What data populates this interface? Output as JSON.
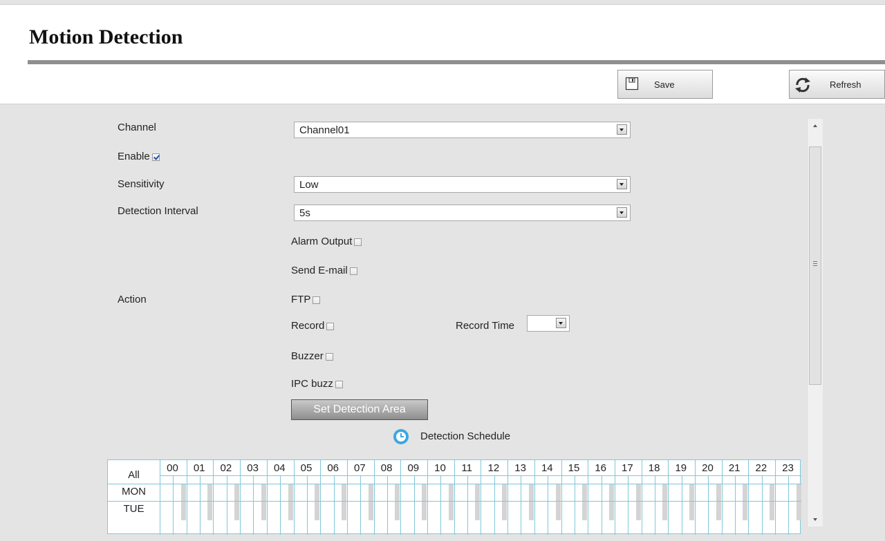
{
  "header": {
    "title": "Motion Detection",
    "save_label": "Save",
    "refresh_label": "Refresh"
  },
  "form": {
    "channel_label": "Channel",
    "channel_value": "Channel01",
    "enable_label": "Enable",
    "enable_checked": true,
    "sensitivity_label": "Sensitivity",
    "sensitivity_value": "Low",
    "interval_label": "Detection Interval",
    "interval_value": "5s",
    "action_label": "Action",
    "actions": {
      "alarm_output": "Alarm Output",
      "send_email": "Send E-mail",
      "ftp": "FTP",
      "record": "Record",
      "record_time": "Record Time",
      "record_time_value": "",
      "buzzer": "Buzzer",
      "ipc_buzz": "IPC buzz"
    },
    "set_area_button": "Set Detection Area",
    "schedule_title": "Detection Schedule"
  },
  "schedule": {
    "all_label": "All",
    "days": [
      "MON",
      "TUE"
    ],
    "hours": [
      "00",
      "01",
      "02",
      "03",
      "04",
      "05",
      "06",
      "07",
      "08",
      "09",
      "10",
      "11",
      "12",
      "13",
      "14",
      "15",
      "16",
      "17",
      "18",
      "19",
      "20",
      "21",
      "22",
      "23"
    ]
  },
  "colors": {
    "grid_line": "#7fc8d8",
    "schedule_icon": "#3aa8e0",
    "title_rule": "#8f8f8f"
  },
  "icons": {
    "save": "floppy-disk-icon",
    "refresh": "refresh-arrows-icon",
    "schedule": "clock-icon"
  }
}
